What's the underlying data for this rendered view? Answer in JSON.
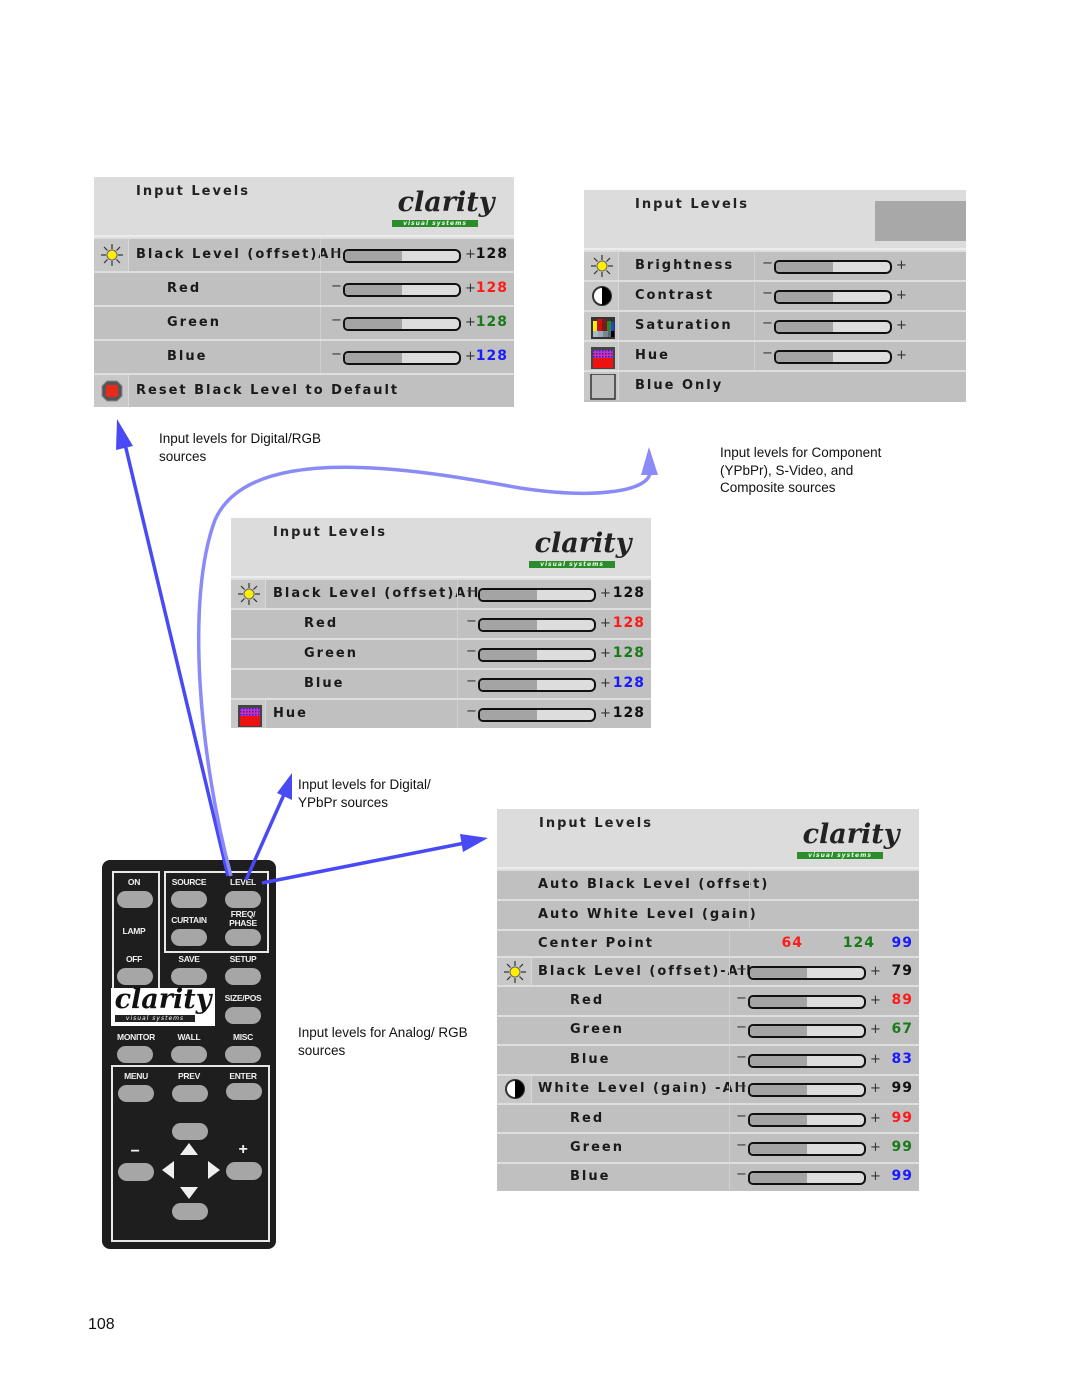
{
  "panels": {
    "rgb": {
      "title": "Input Levels",
      "logo": {
        "word": "clarity",
        "tag": "visual systems"
      },
      "rows": [
        {
          "icon": "brightness-icon",
          "label": "Black Level (offset)All",
          "slider": 0.5,
          "value": "128",
          "value_color": "#111111"
        },
        {
          "icon": "",
          "label": "Red",
          "slider": 0.5,
          "value": "128",
          "value_color": "#ff1a1a"
        },
        {
          "icon": "",
          "label": "Green",
          "slider": 0.5,
          "value": "128",
          "value_color": "#1a7a1a"
        },
        {
          "icon": "",
          "label": "Blue",
          "slider": 0.5,
          "value": "128",
          "value_color": "#1a1aff"
        },
        {
          "icon": "reset-icon",
          "label": "Reset Black Level to Default"
        }
      ]
    },
    "component": {
      "title": "Input Levels",
      "rows": [
        {
          "icon": "brightness-icon",
          "label": "Brightness",
          "slider": 0.5
        },
        {
          "icon": "contrast-icon",
          "label": "Contrast",
          "slider": 0.5
        },
        {
          "icon": "saturation-icon",
          "label": "Saturation",
          "slider": 0.5
        },
        {
          "icon": "hue-icon",
          "label": "Hue",
          "slider": 0.5
        },
        {
          "icon": "blue-only-icon",
          "label": "Blue Only"
        }
      ]
    },
    "digital_ypbpr": {
      "title": "Input Levels",
      "logo": {
        "word": "clarity",
        "tag": "visual systems"
      },
      "rows": [
        {
          "icon": "brightness-icon",
          "label": "Black Level (offset)All",
          "slider": 0.5,
          "value": "128",
          "value_color": "#111111"
        },
        {
          "icon": "",
          "label": "Red",
          "slider": 0.5,
          "value": "128",
          "value_color": "#ff1a1a"
        },
        {
          "icon": "",
          "label": "Green",
          "slider": 0.5,
          "value": "128",
          "value_color": "#1a7a1a"
        },
        {
          "icon": "",
          "label": "Blue",
          "slider": 0.5,
          "value": "128",
          "value_color": "#1a1aff"
        },
        {
          "icon": "hue-icon",
          "label": "Hue",
          "slider": 0.5,
          "value": "128",
          "value_color": "#111111"
        }
      ]
    },
    "analog_rgb": {
      "title": "Input Levels",
      "logo": {
        "word": "clarity",
        "tag": "visual systems"
      },
      "auto_black": "Auto Black Level (offset)",
      "auto_white": "Auto White Level (gain)",
      "center_point": {
        "label": "Center Point",
        "red": "64",
        "green": "124",
        "blue": "99"
      },
      "rows": [
        {
          "icon": "brightness-icon",
          "label": "Black Level (offset)-All",
          "slider": 0.5,
          "value": "79",
          "value_color": "#111111"
        },
        {
          "icon": "",
          "label": "Red",
          "slider": 0.5,
          "value": "89",
          "value_color": "#ff1a1a"
        },
        {
          "icon": "",
          "label": "Green",
          "slider": 0.5,
          "value": "67",
          "value_color": "#1a7a1a"
        },
        {
          "icon": "",
          "label": "Blue",
          "slider": 0.5,
          "value": "83",
          "value_color": "#1a1aff"
        },
        {
          "icon": "contrast-icon",
          "label": "White Level (gain) -All",
          "slider": 0.5,
          "value": "99",
          "value_color": "#111111"
        },
        {
          "icon": "",
          "label": "Red",
          "slider": 0.5,
          "value": "99",
          "value_color": "#ff1a1a"
        },
        {
          "icon": "",
          "label": "Green",
          "slider": 0.5,
          "value": "99",
          "value_color": "#1a7a1a"
        },
        {
          "icon": "",
          "label": "Blue",
          "slider": 0.5,
          "value": "99",
          "value_color": "#1a1aff"
        }
      ]
    }
  },
  "slider_symbols": {
    "minus": "−",
    "plus": "+"
  },
  "captions": {
    "rgb": "Input levels for Digital/RGB sources",
    "component": "Input levels for Component (YPbPr), S-Video, and Composite sources",
    "digital_ypbpr": "Input levels for Digital/ YPbPr sources",
    "analog_rgb": "Input levels for Analog/ RGB sources"
  },
  "remote": {
    "buttons": {
      "on": "ON",
      "source": "SOURCE",
      "level": "LEVEL",
      "lamp": "LAMP",
      "curtain": "CURTAIN",
      "freq_phase": "FREQ/ PHASE",
      "off": "OFF",
      "save": "SAVE",
      "setup": "SETUP",
      "size_pos": "SIZE/POS",
      "monitor": "MONITOR",
      "wall": "WALL",
      "misc": "MISC",
      "menu": "MENU",
      "prev": "PREV",
      "enter": "ENTER",
      "minus": "−",
      "plus": "+"
    },
    "logo": {
      "word": "clarity",
      "tag": "visual systems"
    }
  },
  "colors": {
    "arrow": "#4a4af5",
    "arrow_light": "#8a8af8"
  },
  "page_number": "108"
}
